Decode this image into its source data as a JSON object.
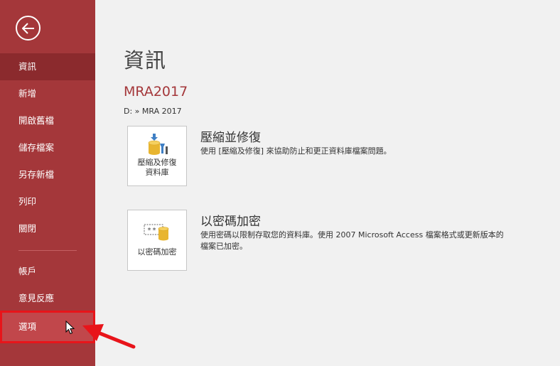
{
  "sidebar": {
    "back_icon": "back-arrow-icon",
    "items": [
      {
        "label": "資訊"
      },
      {
        "label": "新增"
      },
      {
        "label": "開啟舊檔"
      },
      {
        "label": "儲存檔案"
      },
      {
        "label": "另存新檔"
      },
      {
        "label": "列印"
      },
      {
        "label": "關閉"
      },
      {
        "label": "帳戶"
      },
      {
        "label": "意見反應"
      },
      {
        "label": "選項"
      }
    ]
  },
  "main": {
    "title": "資訊",
    "db_name": "MRA2017",
    "db_path": "D: » MRA 2017",
    "sections": [
      {
        "tile_label_line1": "壓縮及修復",
        "tile_label_line2": "資料庫",
        "title": "壓縮並修復",
        "description": "使用 [壓縮及修復] 來協助防止和更正資料庫檔案問題。"
      },
      {
        "tile_label_line1": "以密碼加密",
        "title": "以密碼加密",
        "description_line1": "使用密碼以限制存取您的資料庫。使用 2007 Microsoft Access 檔案格式或更新版本的",
        "description_line2": "檔案已加密。"
      }
    ]
  },
  "colors": {
    "sidebar_bg": "#a4373a",
    "sidebar_active": "#8b2a2d",
    "accent_red": "#e8141a"
  }
}
